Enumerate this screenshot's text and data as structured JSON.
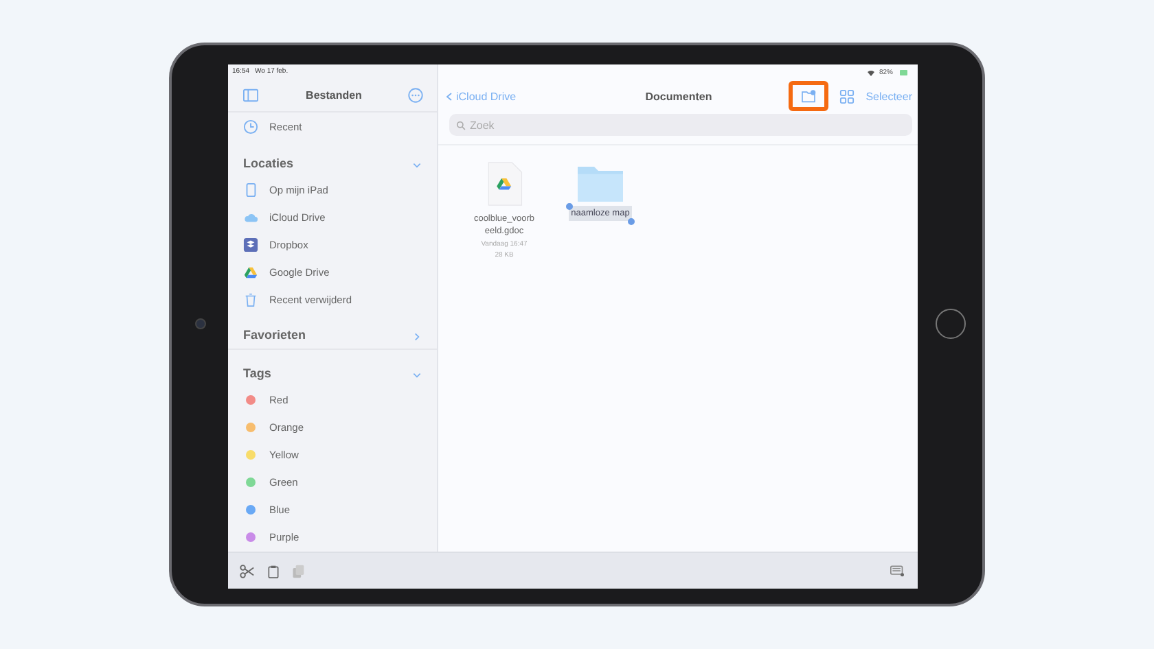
{
  "status_bar": {
    "time": "16:54",
    "date": "Wo 17 feb.",
    "battery": "82%"
  },
  "sidebar": {
    "title": "Bestanden",
    "recent": "Recent",
    "sections": [
      {
        "title": "Locaties",
        "expanded": true,
        "items": [
          {
            "label": "Op mijn iPad",
            "kind": "ipad"
          },
          {
            "label": "iCloud Drive",
            "kind": "cloud"
          },
          {
            "label": "Dropbox",
            "kind": "dropbox"
          },
          {
            "label": "Google Drive",
            "kind": "gdrive"
          },
          {
            "label": "Recent verwijderd",
            "kind": "trash"
          }
        ]
      },
      {
        "title": "Favorieten",
        "expanded": false
      },
      {
        "title": "Tags",
        "expanded": true,
        "items": [
          {
            "label": "Red",
            "kind": "tag",
            "color": "#f28b87"
          },
          {
            "label": "Orange",
            "kind": "tag",
            "color": "#f7bd6e"
          },
          {
            "label": "Yellow",
            "kind": "tag",
            "color": "#f8dc6a"
          },
          {
            "label": "Green",
            "kind": "tag",
            "color": "#7fd896"
          },
          {
            "label": "Blue",
            "kind": "tag",
            "color": "#6aa9f5"
          },
          {
            "label": "Purple",
            "kind": "tag",
            "color": "#c98be8"
          }
        ]
      }
    ]
  },
  "main": {
    "back": "iCloud Drive",
    "title": "Documenten",
    "new_folder_highlighted": true,
    "select": "Selecteer",
    "search": {
      "placeholder": "Zoek"
    },
    "files": [
      {
        "kind": "document",
        "name_lines": [
          "coolblue_voorb",
          "eeld.gdoc"
        ],
        "date": "Vandaag 16:47",
        "size": "28 KB",
        "editing": false
      },
      {
        "kind": "folder",
        "name_lines": [
          "naamloze map"
        ],
        "editing": true
      }
    ]
  }
}
